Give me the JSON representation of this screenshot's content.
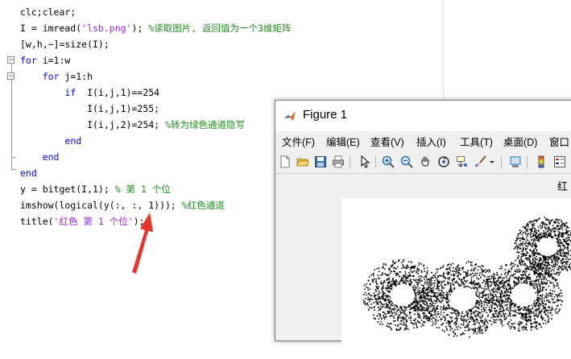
{
  "editor": {
    "lines": [
      {
        "segments": [
          {
            "t": "clc;clear;",
            "c": "plain"
          }
        ]
      },
      {
        "segments": [
          {
            "t": "I = imread(",
            "c": "plain"
          },
          {
            "t": "'lsb.png'",
            "c": "st"
          },
          {
            "t": "); ",
            "c": "plain"
          },
          {
            "t": "%读取图片, 返回值为一个3维矩阵",
            "c": "cm"
          }
        ]
      },
      {
        "segments": [
          {
            "t": "[w,h,~]=size(I);",
            "c": "plain"
          }
        ]
      },
      {
        "segments": [
          {
            "t": "for",
            "c": "kw"
          },
          {
            "t": " i=1:w",
            "c": "plain"
          }
        ]
      },
      {
        "segments": [
          {
            "t": "    ",
            "c": "plain"
          },
          {
            "t": "for",
            "c": "kw"
          },
          {
            "t": " j=1:h",
            "c": "plain"
          }
        ]
      },
      {
        "segments": [
          {
            "t": "        ",
            "c": "plain"
          },
          {
            "t": "if",
            "c": "kw"
          },
          {
            "t": "  I(i,j,1)==254",
            "c": "plain"
          }
        ]
      },
      {
        "segments": [
          {
            "t": "            I(i,j,1)=255;",
            "c": "plain"
          }
        ]
      },
      {
        "segments": [
          {
            "t": "            I(i,j,2)=254; ",
            "c": "plain"
          },
          {
            "t": "%转为绿色通道隐写",
            "c": "cm"
          }
        ]
      },
      {
        "segments": [
          {
            "t": "        ",
            "c": "plain"
          },
          {
            "t": "end",
            "c": "kw"
          }
        ]
      },
      {
        "segments": [
          {
            "t": "    ",
            "c": "plain"
          },
          {
            "t": "end",
            "c": "kw"
          }
        ]
      },
      {
        "segments": [
          {
            "t": "end",
            "c": "kw"
          }
        ]
      },
      {
        "segments": [
          {
            "t": "y = bitget(I,1); ",
            "c": "plain"
          },
          {
            "t": "% 第 1 个位",
            "c": "cm"
          }
        ]
      },
      {
        "segments": [
          {
            "t": "imshow(logical(y(:, :, 1))); ",
            "c": "plain"
          },
          {
            "t": "%红色通道",
            "c": "cm"
          }
        ]
      },
      {
        "segments": [
          {
            "t": "title(",
            "c": "plain"
          },
          {
            "t": "'红色 第 1 个位'",
            "c": "st"
          },
          {
            "t": ");",
            "c": "plain"
          }
        ]
      }
    ]
  },
  "figure": {
    "title": "Figure 1",
    "menu": [
      "文件(F)",
      "编辑(E)",
      "查看(V)",
      "插入(I)",
      "工具(T)",
      "桌面(D)",
      "窗口"
    ],
    "plot_title": "红",
    "toolbar_icons": [
      "new-figure-icon",
      "open-file-icon",
      "save-icon",
      "print-icon",
      "pointer-icon",
      "zoom-in-icon",
      "zoom-out-icon",
      "pan-icon",
      "rotate-3d-icon",
      "data-cursor-icon",
      "brush-icon",
      "brush-dropdown-icon",
      "link-plot-icon",
      "colorbar-icon",
      "legend-icon"
    ]
  },
  "colors": {
    "keyword": "#0000ff",
    "comment": "#228b22",
    "string": "#a020f0",
    "annotation_arrow": "#e8342a"
  }
}
